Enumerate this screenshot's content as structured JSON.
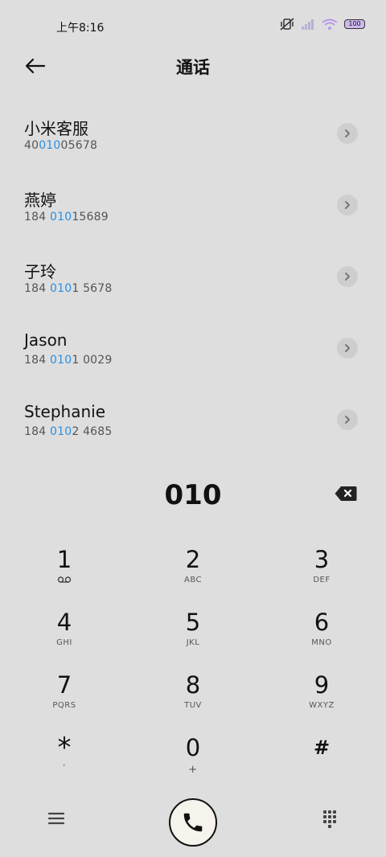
{
  "status": {
    "time": "上午8:16",
    "battery": "100"
  },
  "header": {
    "title": "通话"
  },
  "results": [
    {
      "name": "小米客服",
      "number_pre": "40",
      "number_match": "010",
      "number_post": "05678"
    },
    {
      "name": "燕婷",
      "number_pre": "184 ",
      "number_match": "010",
      "number_post": "15689"
    },
    {
      "name": "子玲",
      "number_pre": "184 ",
      "number_match": "010",
      "number_post": "1 5678"
    },
    {
      "name": "Jason",
      "number_pre": "184 ",
      "number_match": "010",
      "number_post": "1 0029"
    },
    {
      "name": "Stephanie",
      "number_pre": "184 ",
      "number_match": "010",
      "number_post": "2 4685"
    }
  ],
  "dialer": {
    "digits": "010"
  },
  "keypad": [
    {
      "digit": "1",
      "sub": "voicemail-icon"
    },
    {
      "digit": "2",
      "sub": "ABC"
    },
    {
      "digit": "3",
      "sub": "DEF"
    },
    {
      "digit": "4",
      "sub": "GHI"
    },
    {
      "digit": "5",
      "sub": "JKL"
    },
    {
      "digit": "6",
      "sub": "MNO"
    },
    {
      "digit": "7",
      "sub": "PQRS"
    },
    {
      "digit": "8",
      "sub": "TUV"
    },
    {
      "digit": "9",
      "sub": "WXYZ"
    },
    {
      "digit": "*",
      "sub": ","
    },
    {
      "digit": "0",
      "sub": "+"
    },
    {
      "digit": "#",
      "sub": ""
    }
  ],
  "colors": {
    "accent": "#2a8fe0",
    "background": "#dedede"
  }
}
